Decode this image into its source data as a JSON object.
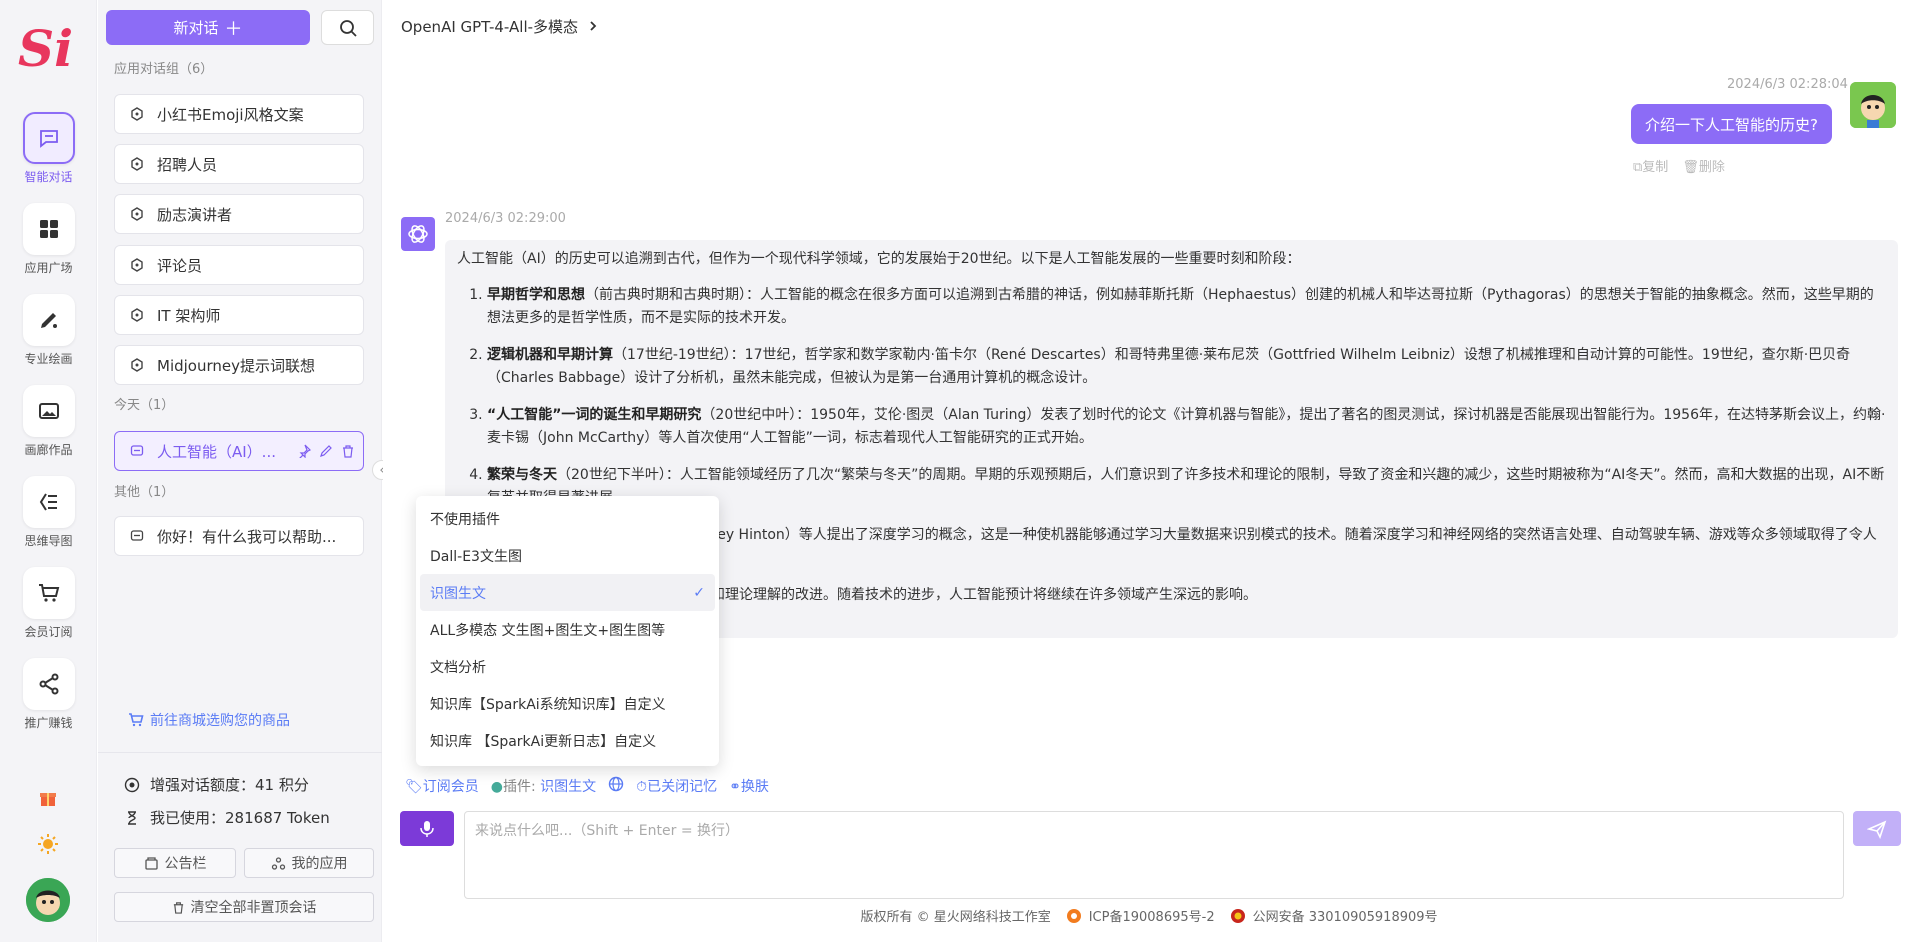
{
  "rail": {
    "logo_text": "Si",
    "items": [
      {
        "label": "智能对话",
        "icon": "chat-icon"
      },
      {
        "label": "应用广场",
        "icon": "grid-icon"
      },
      {
        "label": "专业绘画",
        "icon": "paint-icon"
      },
      {
        "label": "画廊作品",
        "icon": "gallery-icon"
      },
      {
        "label": "思维导图",
        "icon": "mindmap-icon"
      },
      {
        "label": "会员订阅",
        "icon": "cart-icon"
      },
      {
        "label": "推广赚钱",
        "icon": "share-icon"
      }
    ],
    "gift_icon": "gift-icon",
    "theme_icon": "sun-icon"
  },
  "sidebar": {
    "new_chat_label": "新对话",
    "groups": {
      "apps_title": "应用对话组（6）",
      "today_title": "今天（1）",
      "other_title": "其他（1）"
    },
    "app_items": [
      "小红书Emoji风格文案",
      "招聘人员",
      "励志演讲者",
      "评论员",
      "IT 架构师",
      "Midjourney提示词联想"
    ],
    "today_items": [
      "人工智能（AI）..."
    ],
    "other_items": [
      "你好！有什么我可以帮助..."
    ],
    "shop_link": "前往商城选购您的商品",
    "stats": {
      "quota_label": "增强对话额度：",
      "quota_value": "41 积分",
      "used_label": "我已使用：",
      "used_value": "281687 Token"
    },
    "buttons": {
      "notice": "公告栏",
      "my_apps": "我的应用",
      "clear": "清空全部非置顶会话"
    }
  },
  "main": {
    "title": "OpenAI GPT-4-All-多模态",
    "user_msg": {
      "time": "2024/6/3 02:28:04",
      "text": "介绍一下人工智能的历史?",
      "copy": "复制",
      "delete": "删除"
    },
    "ai_msg": {
      "time": "2024/6/3 02:29:00",
      "intro": "人工智能（AI）的历史可以追溯到古代，但作为一个现代科学领域，它的发展始于20世纪。以下是人工智能发展的一些重要时刻和阶段：",
      "items": [
        {
          "title": "早期哲学和思想",
          "text": "（前古典时期和古典时期）：人工智能的概念在很多方面可以追溯到古希腊的神话，例如赫菲斯托斯（Hephaestus）创建的机械人和毕达哥拉斯（Pythagoras）的思想关于智能的抽象概念。然而，这些早期的想法更多的是哲学性质，而不是实际的技术开发。"
        },
        {
          "title": "逻辑机器和早期计算",
          "text": "（17世纪-19世纪）：17世纪，哲学家和数学家勒内·笛卡尔（René Descartes）和哥特弗里德·莱布尼茨（Gottfried Wilhelm Leibniz）设想了机械推理和自动计算的可能性。19世纪，查尔斯·巴贝奇（Charles Babbage）设计了分析机，虽然未能完成，但被认为是第一台通用计算机的概念设计。"
        },
        {
          "title": "“人工智能”一词的诞生和早期研究",
          "text": "（20世纪中叶）：1950年，艾伦·图灵（Alan Turing）发表了划时代的论文《计算机器与智能》，提出了著名的图灵测试，探讨机器是否能展现出智能行为。1956年，在达特茅斯会议上，约翰·麦卡锡（John McCarthy）等人首次使用“人工智能”一词，标志着现代人工智能研究的正式开始。"
        },
        {
          "title": "繁荣与冬天",
          "text": "（20世纪下半叶）：人工智能领域经历了几次“繁荣与冬天”的周期。早期的乐观预期后，人们意识到了许多技术和理论的限制，导致了资金和兴趣的减少，这些时期被称为“AI冬天”。然而，高和大数据的出现，AI不断复苏并取得显著进展。"
        },
        {
          "title": "",
          "text": "今）：2006年，杰弗里·辛顿（Geoffrey Hinton）等人提出了深度学习的概念，这是一种使机器能够通过学习大量数据来识别模式的技术。随着深度学习和神经网络的突然语言处理、自动驾驶车辆、游戏等众多领域取得了令人瞩目的成就。"
        },
        {
          "title": "",
          "text": "，包括算法、计算能力、数据可用性和理论理解的改进。随着技术的进步，人工智能预计将继续在许多领域产生深远的影响。"
        }
      ]
    },
    "plugin_menu": {
      "items": [
        "不使用插件",
        "Dall-E3文生图",
        "识图生文",
        "ALL多模态 文生图+图生文+图生图等",
        "文档分析",
        "知识库【SparkAi系统知识库】自定义",
        "知识库 【SparkAi更新日志】自定义"
      ],
      "selected": "识图生文"
    },
    "toolbar": {
      "subscribe": "订阅会员",
      "plugin_label": "插件:",
      "plugin_value": "识图生文",
      "memory": "已关闭记忆",
      "newline": "换肤"
    },
    "input": {
      "placeholder": "来说点什么吧...（Shift + Enter = 换行）"
    },
    "footer": {
      "copyright": "版权所有 © 星火网络科技工作室",
      "icp": "ICP备19008695号-2",
      "police": "公网安备 33010905918909号"
    },
    "accent": "#8c6cf6"
  }
}
